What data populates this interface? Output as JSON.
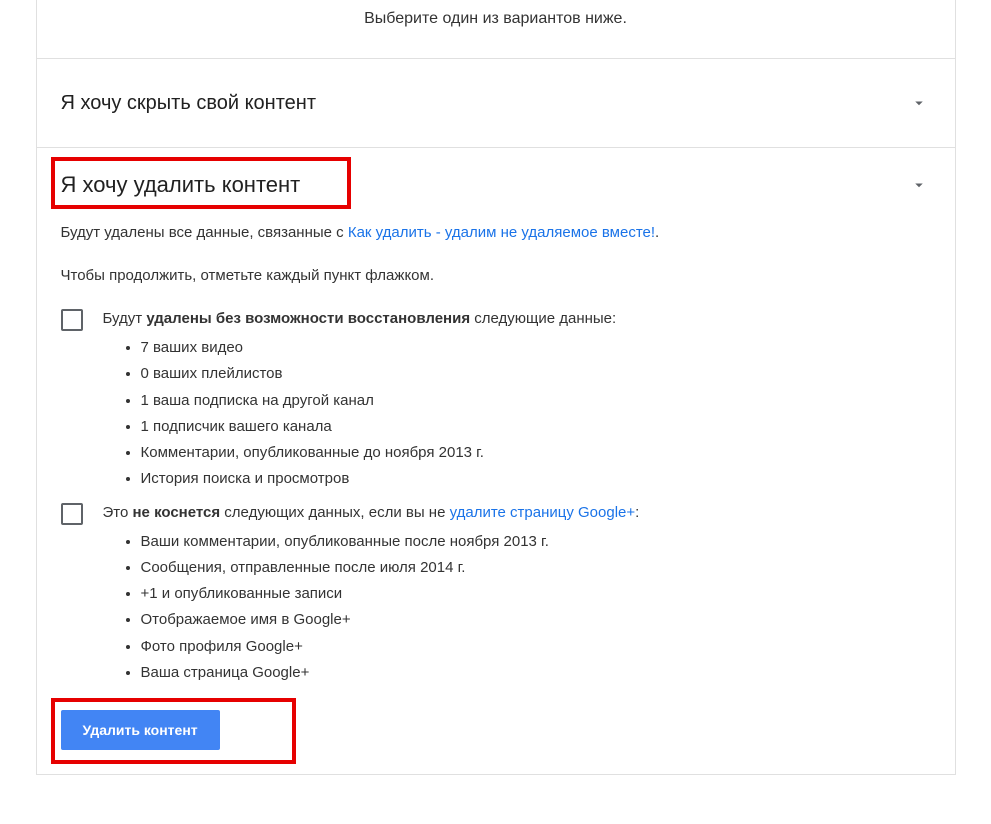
{
  "header": {
    "prompt": "Выберите один из вариантов ниже."
  },
  "sections": {
    "hide": {
      "title": "Я хочу скрыть свой контент"
    },
    "delete": {
      "title": "Я хочу удалить контент",
      "desc_prefix": "Будут удалены все данные, связанные с ",
      "desc_link": "Как удалить - удалим не удаляемое вместе!",
      "desc_suffix": ".",
      "continue_text": "Чтобы продолжить, отметьте каждый пункт флажком.",
      "group1": {
        "lead_prefix": "Будут ",
        "lead_bold": "удалены без возможности восстановления",
        "lead_suffix": " следующие данные:",
        "items": {
          "i0": "7 ваших видео",
          "i1": "0 ваших плейлистов",
          "i2": "1 ваша подписка на другой канал",
          "i3": "1 подписчик вашего канала",
          "i4": "Комментарии, опубликованные до ноября 2013 г.",
          "i5": "История поиска и просмотров"
        }
      },
      "group2": {
        "lead_prefix": "Это ",
        "lead_bold": "не коснется",
        "lead_middle": " следующих данных, если вы не ",
        "lead_link": "удалите страницу Google+",
        "lead_suffix": ":",
        "items": {
          "i0": "Ваши комментарии, опубликованные после ноября 2013 г.",
          "i1": "Сообщения, отправленные после июля 2014 г.",
          "i2": "+1 и опубликованные записи",
          "i3": "Отображаемое имя в Google+",
          "i4": "Фото профиля Google+",
          "i5": "Ваша страница Google+"
        }
      },
      "button_label": "Удалить контент"
    }
  }
}
